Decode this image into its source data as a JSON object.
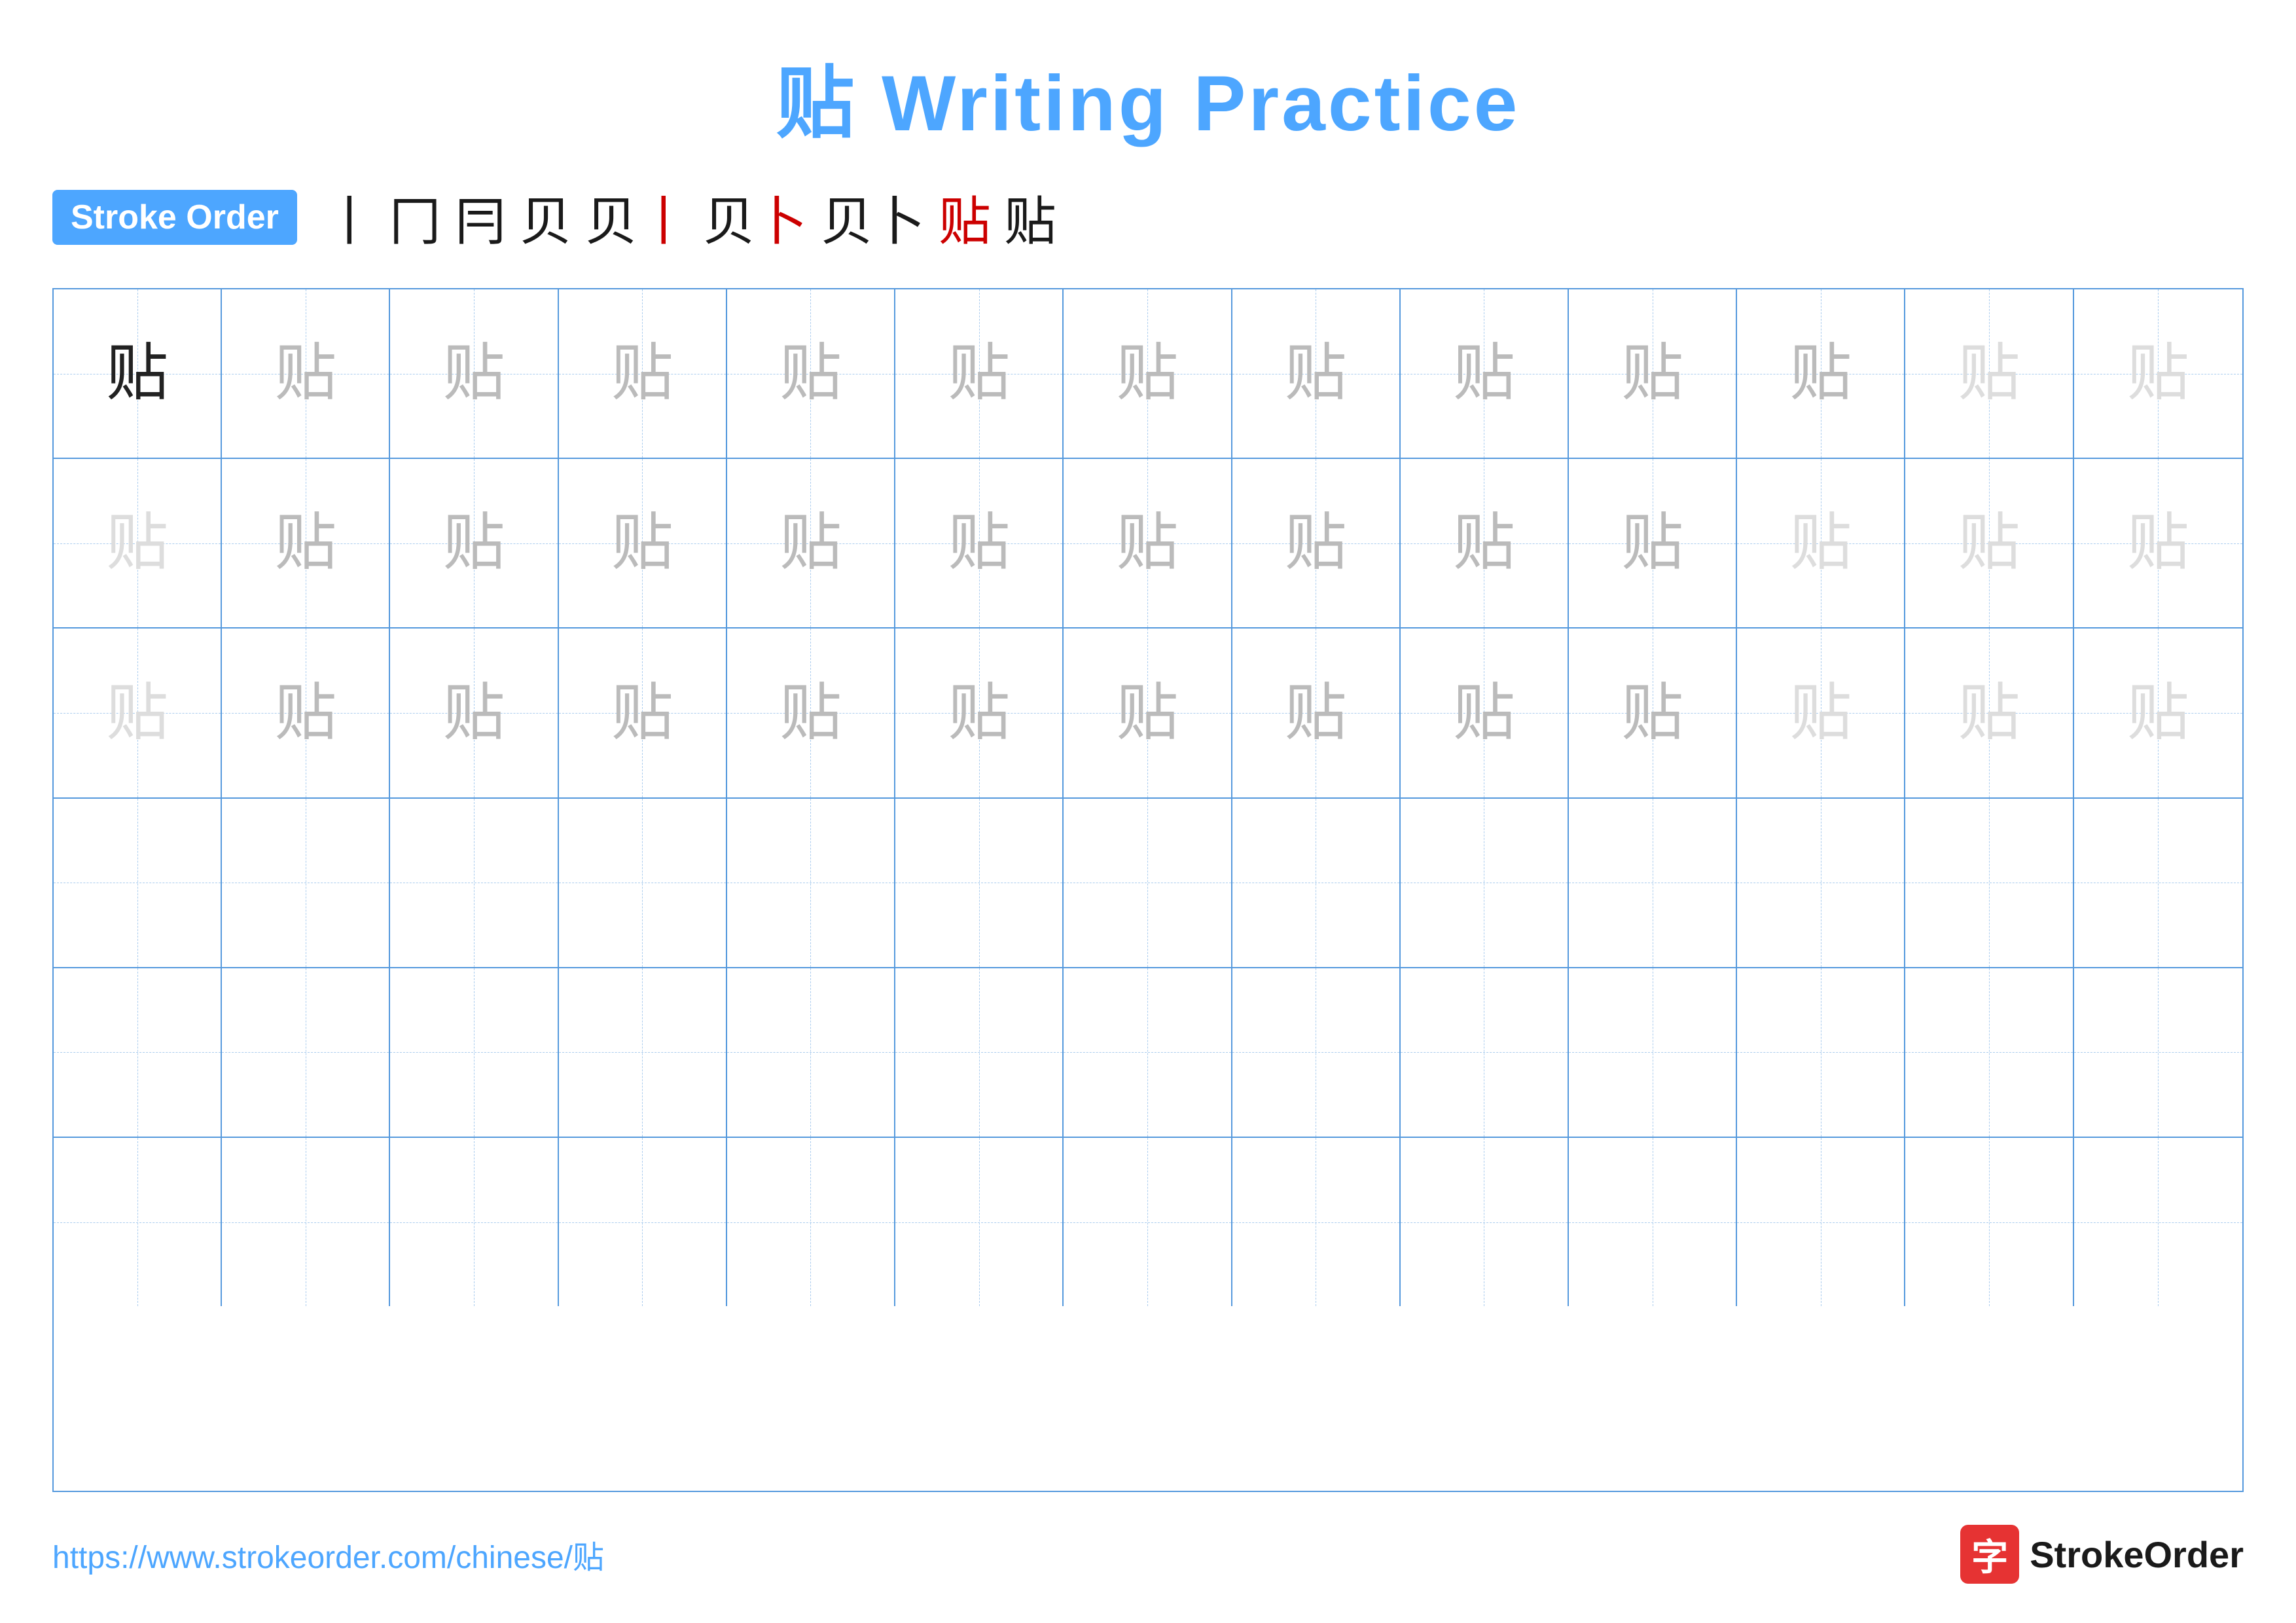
{
  "title": {
    "chinese": "贴",
    "english": "Writing Practice"
  },
  "stroke_order": {
    "badge_label": "Stroke Order",
    "steps": [
      "丨",
      "冂",
      "冃",
      "贝",
      "贝'",
      "贝卜",
      "贝卜",
      "贴",
      "贴"
    ]
  },
  "grid": {
    "rows": [
      {
        "type": "practice",
        "cells": [
          {
            "char": "贴",
            "style": "dark"
          },
          {
            "char": "贴",
            "style": "medium"
          },
          {
            "char": "贴",
            "style": "medium"
          },
          {
            "char": "贴",
            "style": "medium"
          },
          {
            "char": "贴",
            "style": "medium"
          },
          {
            "char": "贴",
            "style": "medium"
          },
          {
            "char": "贴",
            "style": "medium"
          },
          {
            "char": "贴",
            "style": "medium"
          },
          {
            "char": "贴",
            "style": "medium"
          },
          {
            "char": "贴",
            "style": "medium"
          },
          {
            "char": "贴",
            "style": "medium"
          },
          {
            "char": "贴",
            "style": "light"
          },
          {
            "char": "贴",
            "style": "light"
          }
        ]
      },
      {
        "type": "practice",
        "cells": [
          {
            "char": "贴",
            "style": "light"
          },
          {
            "char": "贴",
            "style": "medium"
          },
          {
            "char": "贴",
            "style": "medium"
          },
          {
            "char": "贴",
            "style": "medium"
          },
          {
            "char": "贴",
            "style": "medium"
          },
          {
            "char": "贴",
            "style": "medium"
          },
          {
            "char": "贴",
            "style": "medium"
          },
          {
            "char": "贴",
            "style": "medium"
          },
          {
            "char": "贴",
            "style": "medium"
          },
          {
            "char": "贴",
            "style": "medium"
          },
          {
            "char": "贴",
            "style": "light"
          },
          {
            "char": "贴",
            "style": "light"
          },
          {
            "char": "贴",
            "style": "light"
          }
        ]
      },
      {
        "type": "practice",
        "cells": [
          {
            "char": "贴",
            "style": "light"
          },
          {
            "char": "贴",
            "style": "medium"
          },
          {
            "char": "贴",
            "style": "medium"
          },
          {
            "char": "贴",
            "style": "medium"
          },
          {
            "char": "贴",
            "style": "medium"
          },
          {
            "char": "贴",
            "style": "medium"
          },
          {
            "char": "贴",
            "style": "medium"
          },
          {
            "char": "贴",
            "style": "medium"
          },
          {
            "char": "贴",
            "style": "medium"
          },
          {
            "char": "贴",
            "style": "medium"
          },
          {
            "char": "贴",
            "style": "light"
          },
          {
            "char": "贴",
            "style": "light"
          },
          {
            "char": "贴",
            "style": "light"
          }
        ]
      },
      {
        "type": "empty"
      },
      {
        "type": "empty"
      },
      {
        "type": "empty"
      }
    ]
  },
  "footer": {
    "url": "https://www.strokeorder.com/chinese/贴",
    "logo_char": "字",
    "logo_text": "StrokeOrder"
  }
}
